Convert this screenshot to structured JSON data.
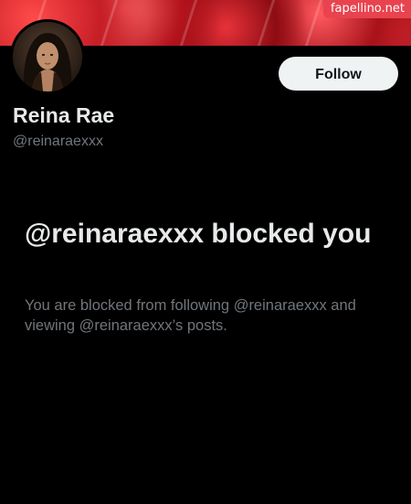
{
  "watermark": "fapellino.net",
  "profile": {
    "display_name": "Reina Rae",
    "handle": "@reinaraexxx",
    "follow_label": "Follow"
  },
  "blocked": {
    "title": "@reinaraexxx blocked you",
    "message": "You are blocked from following @reinaraexxx and viewing @reinaraexxx’s posts."
  },
  "colors": {
    "background": "#000000",
    "banner_accent": "#c61e26",
    "watermark_bg": "#e8434f",
    "primary_text": "#e7e9ea",
    "secondary_text": "#71767b",
    "follow_button_bg": "#eff3f4"
  }
}
